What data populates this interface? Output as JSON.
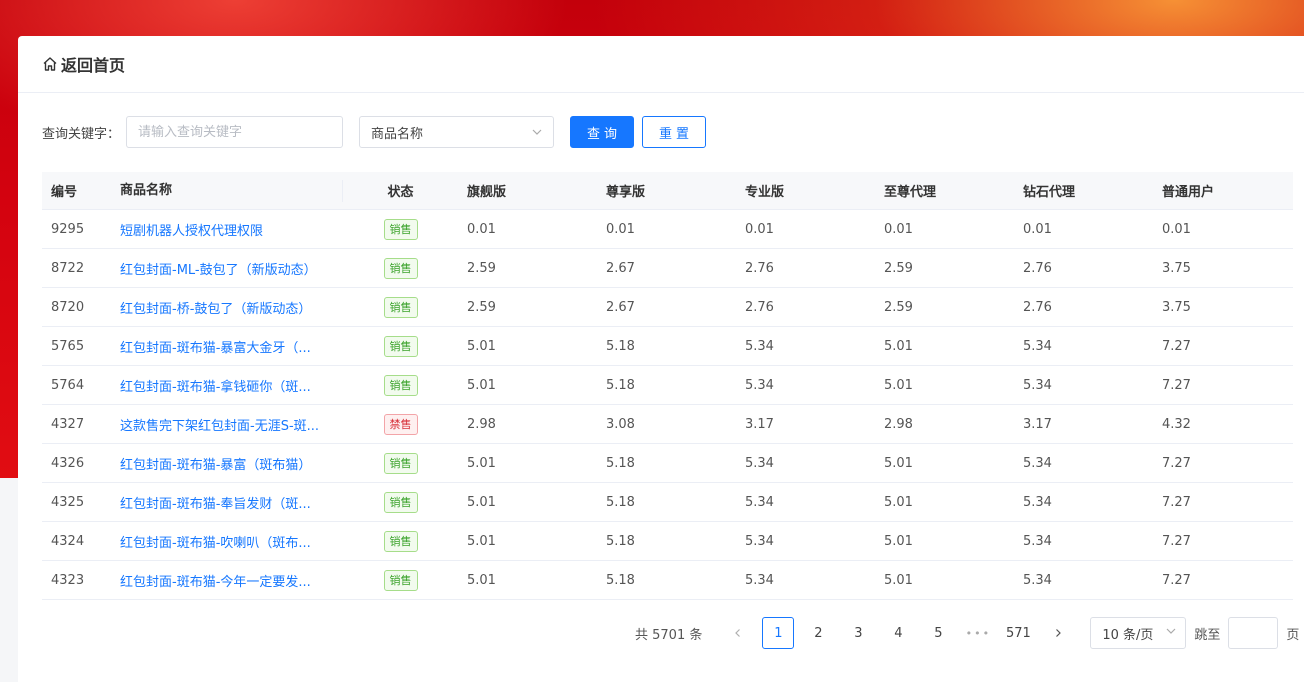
{
  "header": {
    "home_label": "返回首页"
  },
  "search": {
    "label": "查询关键字：",
    "placeholder": "请输入查询关键字",
    "field_select": "商品名称",
    "query_button": "查询",
    "reset_button": "重置"
  },
  "table": {
    "columns": [
      "编号",
      "商品名称",
      "状态",
      "旗舰版",
      "尊享版",
      "专业版",
      "至尊代理",
      "钻石代理",
      "普通用户"
    ],
    "rows": [
      {
        "id": "9295",
        "name": "短剧机器人授权代理权限",
        "status": "销售",
        "p1": "0.01",
        "p2": "0.01",
        "p3": "0.01",
        "p4": "0.01",
        "p5": "0.01",
        "p6": "0.01"
      },
      {
        "id": "8722",
        "name": "红包封面-ML-鼓包了（新版动态）",
        "status": "销售",
        "p1": "2.59",
        "p2": "2.67",
        "p3": "2.76",
        "p4": "2.59",
        "p5": "2.76",
        "p6": "3.75"
      },
      {
        "id": "8720",
        "name": "红包封面-桥-鼓包了（新版动态）",
        "status": "销售",
        "p1": "2.59",
        "p2": "2.67",
        "p3": "2.76",
        "p4": "2.59",
        "p5": "2.76",
        "p6": "3.75"
      },
      {
        "id": "5765",
        "name": "红包封面-斑布猫-暴富大金牙（...",
        "status": "销售",
        "p1": "5.01",
        "p2": "5.18",
        "p3": "5.34",
        "p4": "5.01",
        "p5": "5.34",
        "p6": "7.27"
      },
      {
        "id": "5764",
        "name": "红包封面-斑布猫-拿钱砸你（斑...",
        "status": "销售",
        "p1": "5.01",
        "p2": "5.18",
        "p3": "5.34",
        "p4": "5.01",
        "p5": "5.34",
        "p6": "7.27"
      },
      {
        "id": "4327",
        "name": "这款售完下架红包封面-无涯S-斑...",
        "status": "禁售",
        "p1": "2.98",
        "p2": "3.08",
        "p3": "3.17",
        "p4": "2.98",
        "p5": "3.17",
        "p6": "4.32"
      },
      {
        "id": "4326",
        "name": "红包封面-斑布猫-暴富（斑布猫）",
        "status": "销售",
        "p1": "5.01",
        "p2": "5.18",
        "p3": "5.34",
        "p4": "5.01",
        "p5": "5.34",
        "p6": "7.27"
      },
      {
        "id": "4325",
        "name": "红包封面-斑布猫-奉旨发财（斑...",
        "status": "销售",
        "p1": "5.01",
        "p2": "5.18",
        "p3": "5.34",
        "p4": "5.01",
        "p5": "5.34",
        "p6": "7.27"
      },
      {
        "id": "4324",
        "name": "红包封面-斑布猫-吹喇叭（斑布...",
        "status": "销售",
        "p1": "5.01",
        "p2": "5.18",
        "p3": "5.34",
        "p4": "5.01",
        "p5": "5.34",
        "p6": "7.27"
      },
      {
        "id": "4323",
        "name": "红包封面-斑布猫-今年一定要发...",
        "status": "销售",
        "p1": "5.01",
        "p2": "5.18",
        "p3": "5.34",
        "p4": "5.01",
        "p5": "5.34",
        "p6": "7.27"
      }
    ]
  },
  "pagination": {
    "total_text": "共 5701 条",
    "pages": [
      "1",
      "2",
      "3",
      "4",
      "5"
    ],
    "current": "1",
    "ellipsis": "•••",
    "last_page": "571",
    "page_size": "10 条/页",
    "jump_label": "跳至",
    "jump_value": "",
    "page_unit": "页"
  },
  "colors": {
    "primary": "#1677ff",
    "sale_tag": "#3aa22a",
    "ban_tag": "#d8323a",
    "banner": "#d3020f"
  }
}
